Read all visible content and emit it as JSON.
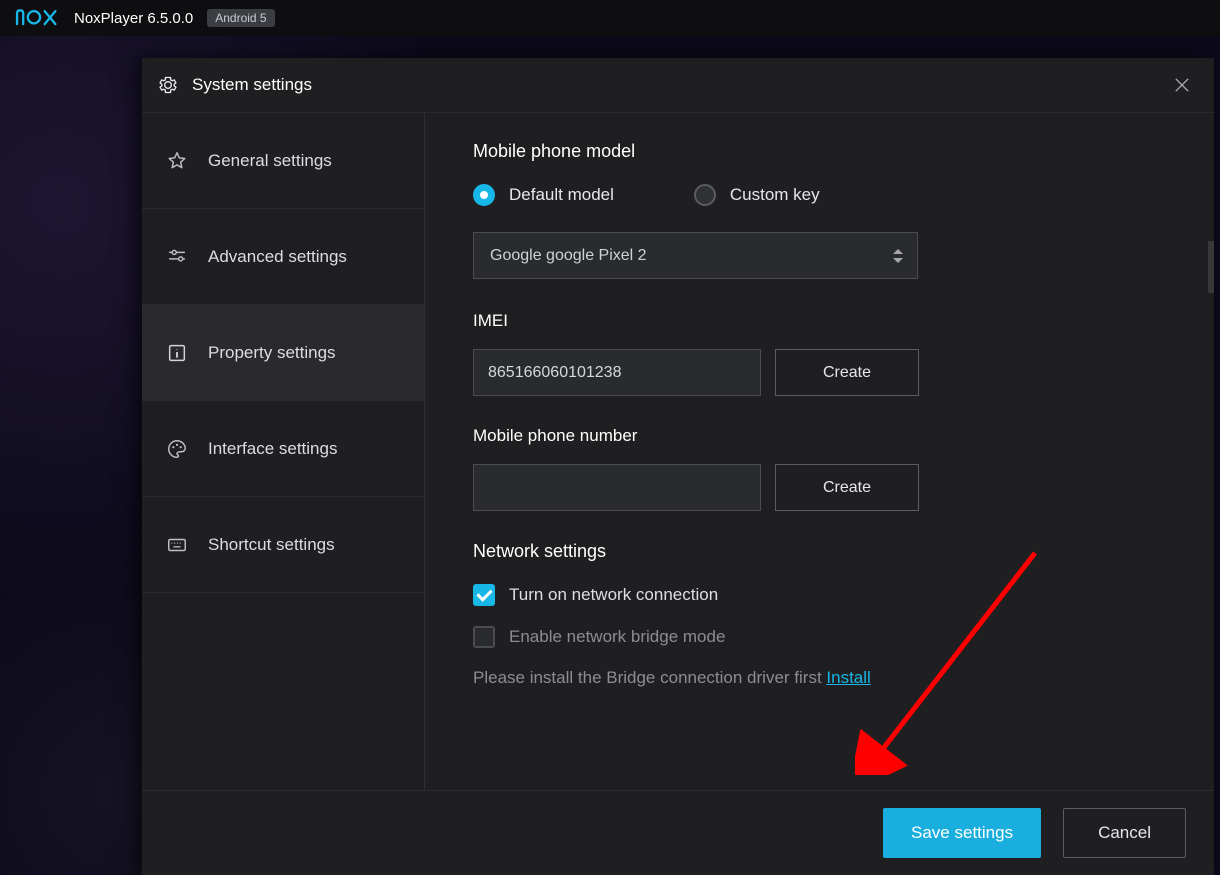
{
  "titlebar": {
    "app_name": "NoxPlayer 6.5.0.0",
    "android_badge": "Android 5"
  },
  "dialog": {
    "title": "System settings",
    "sidebar": {
      "items": [
        {
          "id": "general",
          "label": "General settings"
        },
        {
          "id": "advanced",
          "label": "Advanced settings"
        },
        {
          "id": "property",
          "label": "Property settings"
        },
        {
          "id": "interface",
          "label": "Interface settings"
        },
        {
          "id": "shortcut",
          "label": "Shortcut settings"
        }
      ],
      "active_id": "property"
    },
    "content": {
      "phone_model": {
        "title": "Mobile phone model",
        "options": {
          "default": "Default model",
          "custom": "Custom key"
        },
        "selected_option": "default",
        "model_value": "Google google Pixel 2"
      },
      "imei": {
        "label": "IMEI",
        "value": "865166060101238",
        "create_label": "Create"
      },
      "phone_number": {
        "label": "Mobile phone number",
        "value": "",
        "create_label": "Create"
      },
      "network": {
        "title": "Network settings",
        "turn_on_label": "Turn on network connection",
        "turn_on_checked": true,
        "bridge_label": "Enable network bridge mode",
        "bridge_checked": false,
        "bridge_enabled": false,
        "hint_text": "Please install the Bridge connection driver first ",
        "install_link": "Install"
      }
    },
    "footer": {
      "save_label": "Save settings",
      "cancel_label": "Cancel"
    }
  }
}
